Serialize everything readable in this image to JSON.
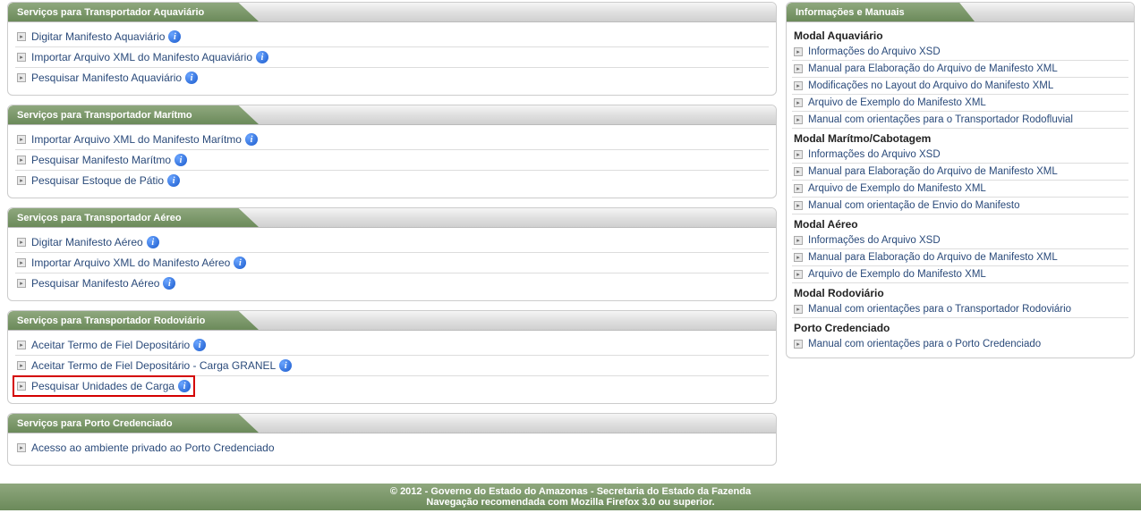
{
  "left_panels": [
    {
      "title": "Serviços para Transportador Aquaviário",
      "items": [
        {
          "label": "Digitar Manifesto Aquaviário",
          "info": true
        },
        {
          "label": "Importar Arquivo XML do Manifesto Aquaviário",
          "info": true
        },
        {
          "label": "Pesquisar Manifesto Aquaviário",
          "info": true
        }
      ]
    },
    {
      "title": "Serviços para Transportador Marítmo",
      "items": [
        {
          "label": "Importar Arquivo XML do Manifesto Marítmo",
          "info": true
        },
        {
          "label": "Pesquisar Manifesto Marítmo",
          "info": true
        },
        {
          "label": "Pesquisar Estoque de Pátio",
          "info": true
        }
      ]
    },
    {
      "title": "Serviços para Transportador Aéreo",
      "items": [
        {
          "label": "Digitar Manifesto Aéreo",
          "info": true
        },
        {
          "label": "Importar Arquivo XML do Manifesto Aéreo",
          "info": true
        },
        {
          "label": "Pesquisar Manifesto Aéreo",
          "info": true
        }
      ]
    },
    {
      "title": "Serviços para Transportador Rodoviário",
      "items": [
        {
          "label": "Aceitar Termo de Fiel Depositário",
          "info": true
        },
        {
          "label": "Aceitar Termo de Fiel Depositário - Carga GRANEL",
          "info": true
        },
        {
          "label": "Pesquisar Unidades de Carga",
          "info": true,
          "highlight": true
        }
      ]
    },
    {
      "title": "Serviços para Porto Credenciado",
      "items": [
        {
          "label": "Acesso ao ambiente privado ao Porto Credenciado",
          "info": false
        }
      ]
    }
  ],
  "right_panel": {
    "title": "Informações e Manuais",
    "sections": [
      {
        "heading": "Modal Aquaviário",
        "items": [
          "Informações do Arquivo XSD",
          "Manual para Elaboração do Arquivo de Manifesto XML",
          "Modificações no Layout do Arquivo do Manifesto XML",
          "Arquivo de Exemplo do Manifesto XML",
          "Manual com orientações para o Transportador Rodofluvial"
        ]
      },
      {
        "heading": "Modal Marítmo/Cabotagem",
        "items": [
          "Informações do Arquivo XSD",
          "Manual para Elaboração do Arquivo de Manifesto XML",
          "Arquivo de Exemplo do Manifesto XML",
          "Manual com orientação de Envio do Manifesto"
        ]
      },
      {
        "heading": "Modal Aéreo",
        "items": [
          "Informações do Arquivo XSD",
          "Manual para Elaboração do Arquivo de Manifesto XML",
          "Arquivo de Exemplo do Manifesto XML"
        ]
      },
      {
        "heading": "Modal Rodoviário",
        "items": [
          "Manual com orientações para o Transportador Rodoviário"
        ]
      },
      {
        "heading": "Porto Credenciado",
        "items": [
          "Manual com orientações para o Porto Credenciado"
        ]
      }
    ]
  },
  "footer": {
    "line1": "© 2012 - Governo do Estado do Amazonas - Secretaria do Estado da Fazenda",
    "line2": "Navegação recomendada com Mozilla Firefox 3.0 ou superior."
  }
}
